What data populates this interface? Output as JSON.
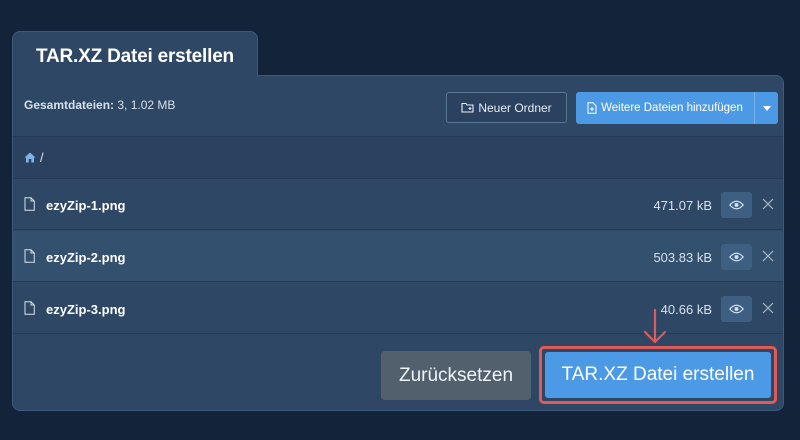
{
  "tab": {
    "title": "TAR.XZ Datei erstellen"
  },
  "toolbar": {
    "total_label": "Gesamtdateien:",
    "total_value": "3, 1.02 MB",
    "new_folder_label": "Neuer Ordner",
    "add_files_label": "Weitere Dateien hinzufügen"
  },
  "breadcrumb": {
    "separator": "/"
  },
  "files": [
    {
      "name": "ezyZip-1.png",
      "size": "471.07 kB"
    },
    {
      "name": "ezyZip-2.png",
      "size": "503.83 kB"
    },
    {
      "name": "ezyZip-3.png",
      "size": "40.66 kB"
    }
  ],
  "footer": {
    "reset_label": "Zurücksetzen",
    "create_label": "TAR.XZ Datei erstellen"
  },
  "colors": {
    "background": "#13243a",
    "panel": "#2d4765",
    "accent": "#4c9ae6",
    "highlight": "#e05a57"
  }
}
